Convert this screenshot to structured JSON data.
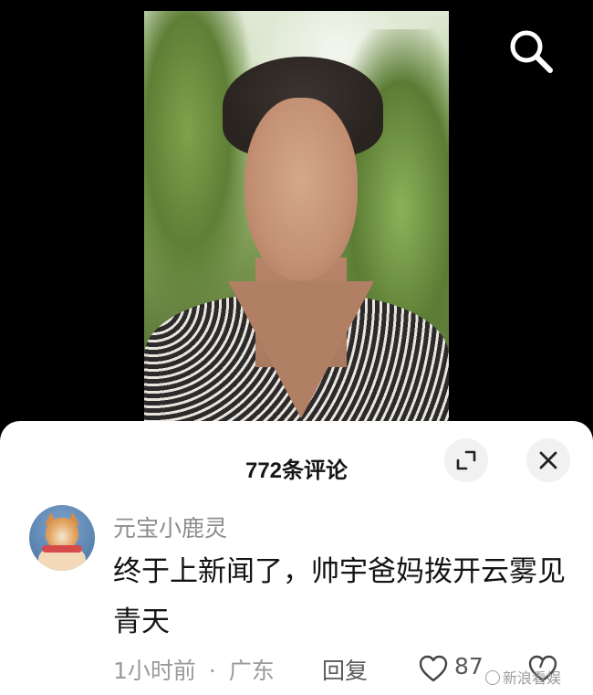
{
  "video": {
    "search_icon": "search-icon"
  },
  "comments_sheet": {
    "title": "772条评论",
    "expand_icon": "expand-icon",
    "close_icon": "close-icon",
    "comment": {
      "username": "元宝小鹿灵",
      "text": "终于上新闻了，帅宇爸妈拨开云雾见青天",
      "time": "1小时前",
      "separator": "·",
      "location": "广东",
      "reply_label": "回复",
      "like_count": "87",
      "avatar_icon": "shiba-dog-avatar"
    }
  },
  "watermark": "新浪看娱",
  "colors": {
    "sheet_background": "#ffffff",
    "title_text": "#161616",
    "username_text": "#8d8d8d",
    "meta_text": "#9a9a9a"
  }
}
